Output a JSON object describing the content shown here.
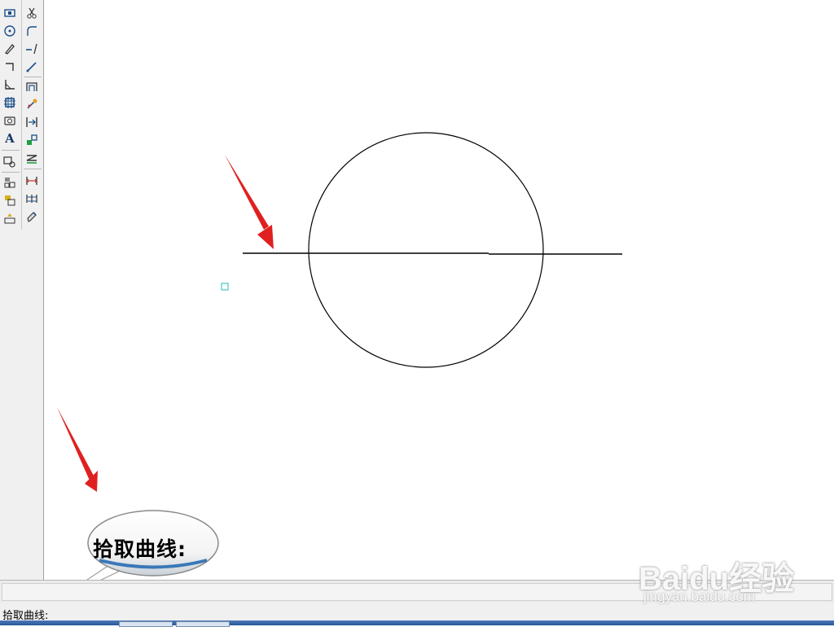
{
  "toolbar": {
    "left_tools": [
      "rectangle-icon",
      "circle-icon",
      "pencil-icon",
      "bracket-icon",
      "angle-icon",
      "hatch-icon",
      "camera-icon",
      "text-icon",
      "zoom-window-icon",
      "block-icon",
      "block-edit-icon",
      "block-insert-icon"
    ],
    "right_tools": [
      "scissors-icon",
      "fillet-icon",
      "extend-icon",
      "line-icon",
      "offset-icon",
      "explode-icon",
      "move-icon",
      "mirror-icon",
      "layer-icon",
      "dimension-icon",
      "dimension-chain-icon",
      "brush-icon"
    ],
    "text_tool_label": "A"
  },
  "callout": {
    "text": "拾取曲线:"
  },
  "status_bar": {
    "prompt": "拾取曲线:"
  },
  "watermark": {
    "brand": "Baidu经验",
    "url": "jingyan.baidu.com"
  },
  "colors": {
    "arrow": "#e02020",
    "selection_marker": "#20c0b0",
    "drawing": "#000000"
  }
}
